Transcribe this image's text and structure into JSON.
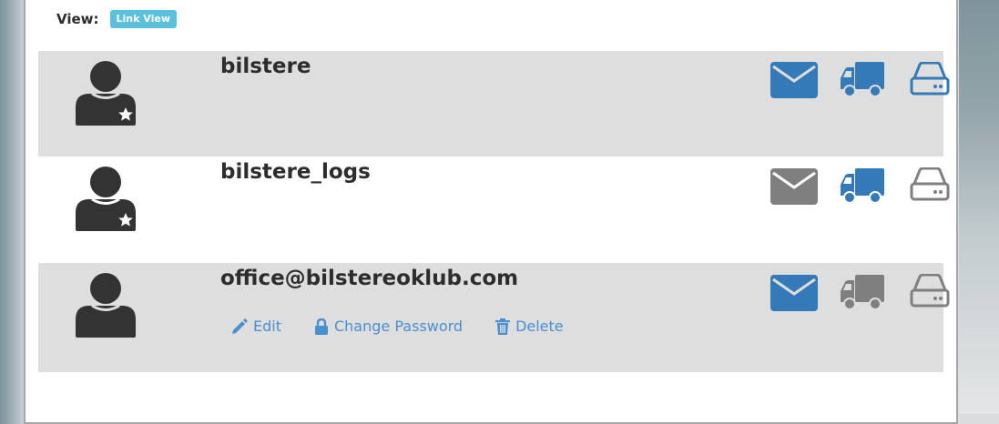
{
  "view": {
    "label": "View:",
    "mode": "Link View"
  },
  "colors": {
    "active": "#3479b8",
    "inactive": "#7f7f7f",
    "badge": "#5bc0de",
    "row_gray": "#dedede",
    "link": "#4a8fd0"
  },
  "accounts": [
    {
      "username": "bilstere",
      "starred": true,
      "mail": "active",
      "delivery": "active",
      "storage": "active"
    },
    {
      "username": "bilstere_logs",
      "starred": true,
      "mail": "inactive",
      "delivery": "active",
      "storage": "inactive"
    },
    {
      "username": "office@bilstereoklub.com",
      "starred": false,
      "mail": "active",
      "delivery": "inactive",
      "storage": "inactive"
    }
  ],
  "actions": {
    "edit": "Edit",
    "change_password": "Change Password",
    "delete": "Delete"
  },
  "icons": {
    "mail": "envelope-icon",
    "delivery": "truck-icon",
    "storage": "hard-drive-icon",
    "avatar": "user-icon",
    "star": "star-icon"
  }
}
